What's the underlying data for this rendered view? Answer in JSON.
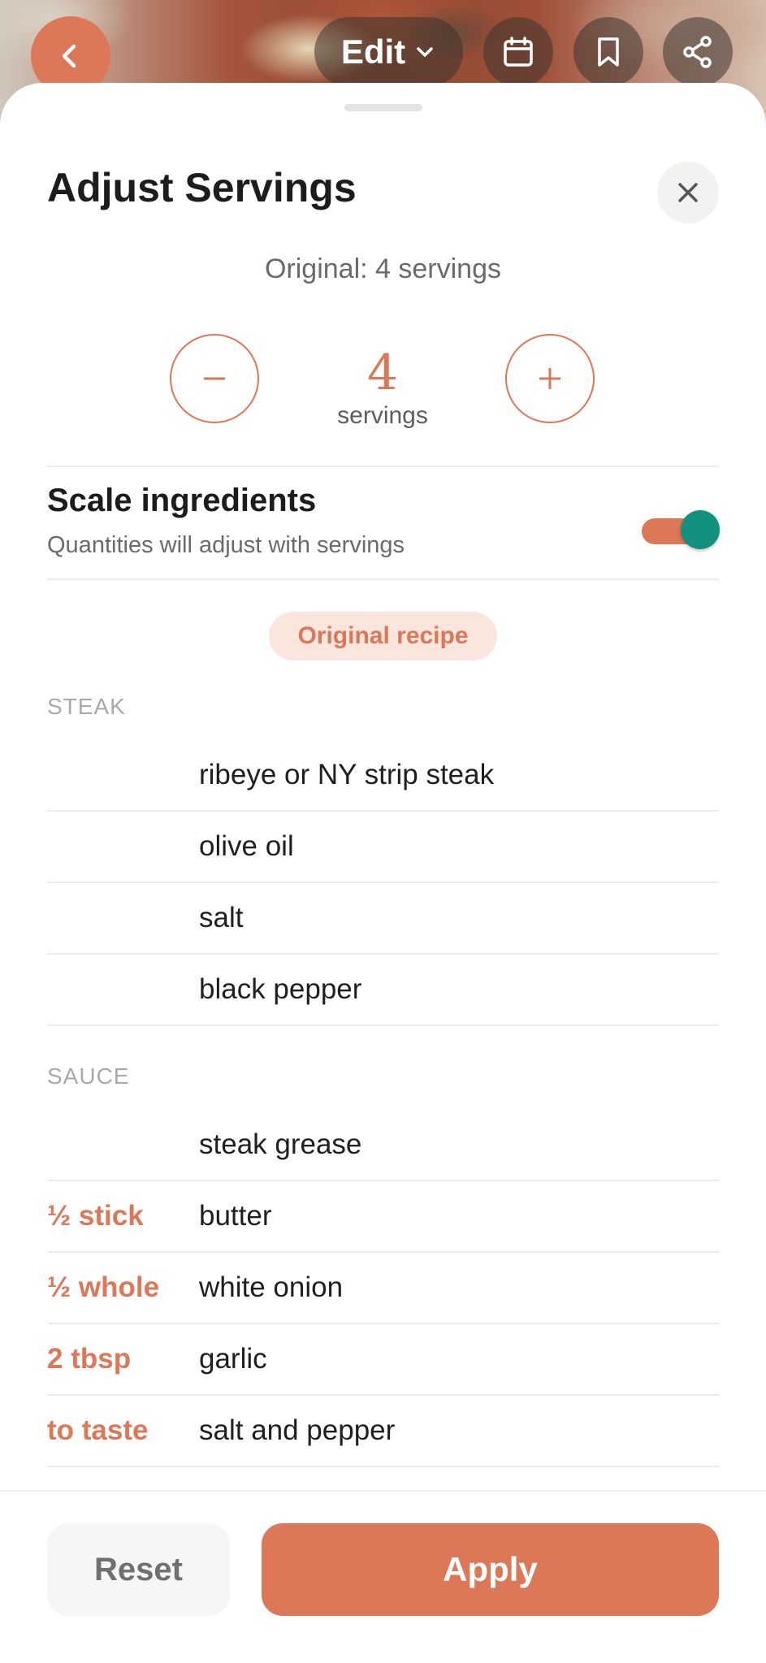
{
  "header": {
    "edit_label": "Edit",
    "back_icon": "chevron-left-icon",
    "calendar_icon": "calendar-icon",
    "bookmark_icon": "bookmark-icon",
    "share_icon": "share-icon"
  },
  "sheet": {
    "title": "Adjust Servings",
    "original_text": "Original: 4 servings",
    "servings_count": "4",
    "servings_label": "servings",
    "scale": {
      "title": "Scale ingredients",
      "subtitle": "Quantities will adjust with servings",
      "enabled": true
    },
    "badge": "Original recipe",
    "sections": [
      {
        "name": "STEAK",
        "items": [
          {
            "qty": "",
            "name": "ribeye or NY strip steak"
          },
          {
            "qty": "",
            "name": "olive oil"
          },
          {
            "qty": "",
            "name": "salt"
          },
          {
            "qty": "",
            "name": "black pepper"
          }
        ]
      },
      {
        "name": "SAUCE",
        "items": [
          {
            "qty": "",
            "name": "steak grease"
          },
          {
            "qty": "½ stick",
            "name": "butter"
          },
          {
            "qty": "½ whole",
            "name": "white onion"
          },
          {
            "qty": "2 tbsp",
            "name": "garlic"
          },
          {
            "qty": "to taste",
            "name": "salt and pepper"
          }
        ]
      }
    ]
  },
  "footer": {
    "reset_label": "Reset",
    "apply_label": "Apply"
  },
  "colors": {
    "accent": "#dc7757",
    "toggle_knob": "#12917f",
    "badge_bg": "#fbe6de"
  }
}
